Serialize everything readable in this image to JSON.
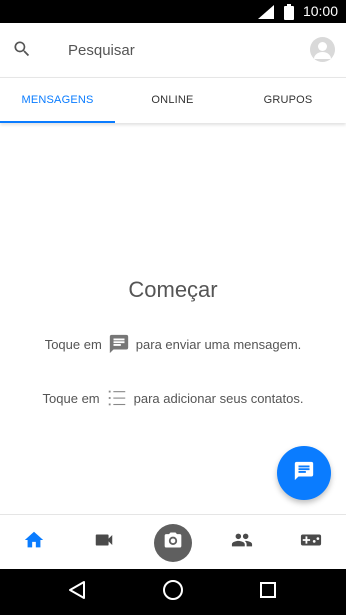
{
  "status_bar": {
    "time": "10:00",
    "icons": [
      "signal-icon",
      "battery-icon"
    ]
  },
  "search": {
    "placeholder": "Pesquisar",
    "value": ""
  },
  "tabs": [
    {
      "label": "MENSAGENS",
      "active": true
    },
    {
      "label": "ONLINE",
      "active": false
    },
    {
      "label": "GRUPOS",
      "active": false
    }
  ],
  "empty_state": {
    "title": "Começar",
    "hint1": {
      "before": "Toque em",
      "after": "para enviar uma mensagem.",
      "icon": "message-icon"
    },
    "hint2": {
      "before": "Toque em",
      "after": "para adicionar seus contatos.",
      "icon": "list-icon"
    }
  },
  "fab": {
    "icon": "compose-message-icon"
  },
  "bottom_nav": {
    "items": [
      {
        "icon": "home-icon",
        "active": true
      },
      {
        "icon": "video-icon",
        "active": false
      },
      {
        "icon": "camera-icon",
        "active": false
      },
      {
        "icon": "people-icon",
        "active": false
      },
      {
        "icon": "game-controller-icon",
        "active": false
      }
    ]
  },
  "system_nav": {
    "icons": [
      "back-icon",
      "home-circle-icon",
      "recents-icon"
    ]
  },
  "colors": {
    "accent": "#0a7cff",
    "text": "#555555",
    "icon_gray": "#4a4a4a",
    "camera_bg": "#5f5f5f"
  }
}
